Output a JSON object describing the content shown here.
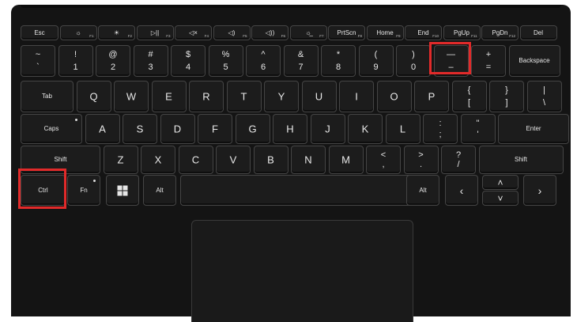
{
  "keyboard": {
    "fn_row": [
      {
        "name": "esc-key",
        "label": "Esc"
      },
      {
        "name": "f1-key",
        "label": "☼",
        "sub": "F1"
      },
      {
        "name": "f2-key",
        "label": "☀",
        "sub": "F2"
      },
      {
        "name": "f3-key",
        "label": "▷||",
        "sub": "F3"
      },
      {
        "name": "f4-key",
        "label": "◁×",
        "sub": "F4"
      },
      {
        "name": "f5-key",
        "label": "◁)",
        "sub": "F5"
      },
      {
        "name": "f6-key",
        "label": "◁))",
        "sub": "F6"
      },
      {
        "name": "f7-key",
        "label": "☼̲",
        "sub": "F7"
      },
      {
        "name": "prtscn-key",
        "label": "PrtScn",
        "sub": "F8"
      },
      {
        "name": "home-key",
        "label": "Home",
        "sub": "F9"
      },
      {
        "name": "end-key",
        "label": "End",
        "sub": "F10"
      },
      {
        "name": "pgup-key",
        "label": "PgUp",
        "sub": "F11"
      },
      {
        "name": "pgdn-key",
        "label": "PgDn",
        "sub": "F12"
      },
      {
        "name": "del-key",
        "label": "Del"
      }
    ],
    "number_row": [
      {
        "name": "tilde-key",
        "top": "~",
        "bottom": "`"
      },
      {
        "name": "1-key",
        "top": "!",
        "bottom": "1"
      },
      {
        "name": "2-key",
        "top": "@",
        "bottom": "2"
      },
      {
        "name": "3-key",
        "top": "#",
        "bottom": "3"
      },
      {
        "name": "4-key",
        "top": "$",
        "bottom": "4"
      },
      {
        "name": "5-key",
        "top": "%",
        "bottom": "5"
      },
      {
        "name": "6-key",
        "top": "^",
        "bottom": "6"
      },
      {
        "name": "7-key",
        "top": "&",
        "bottom": "7"
      },
      {
        "name": "8-key",
        "top": "*",
        "bottom": "8"
      },
      {
        "name": "9-key",
        "top": "(",
        "bottom": "9"
      },
      {
        "name": "0-key",
        "top": ")",
        "bottom": "0"
      },
      {
        "name": "minus-key",
        "top": "—",
        "bottom": "–"
      },
      {
        "name": "equals-key",
        "top": "+",
        "bottom": "="
      },
      {
        "name": "backspace-key",
        "label": "Backspace"
      }
    ],
    "qwerty_row": [
      {
        "name": "tab-key",
        "label": "Tab"
      },
      {
        "name": "q-key",
        "label": "Q"
      },
      {
        "name": "w-key",
        "label": "W"
      },
      {
        "name": "e-key",
        "label": "E"
      },
      {
        "name": "r-key",
        "label": "R"
      },
      {
        "name": "t-key",
        "label": "T"
      },
      {
        "name": "y-key",
        "label": "Y"
      },
      {
        "name": "u-key",
        "label": "U"
      },
      {
        "name": "i-key",
        "label": "I"
      },
      {
        "name": "o-key",
        "label": "O"
      },
      {
        "name": "p-key",
        "label": "P"
      },
      {
        "name": "bracket-left-key",
        "top": "{",
        "bottom": "["
      },
      {
        "name": "bracket-right-key",
        "top": "}",
        "bottom": "]"
      },
      {
        "name": "backslash-key",
        "top": "|",
        "bottom": "\\"
      }
    ],
    "home_row": [
      {
        "name": "caps-key",
        "label": "Caps"
      },
      {
        "name": "a-key",
        "label": "A"
      },
      {
        "name": "s-key",
        "label": "S"
      },
      {
        "name": "d-key",
        "label": "D"
      },
      {
        "name": "f-key",
        "label": "F"
      },
      {
        "name": "g-key",
        "label": "G"
      },
      {
        "name": "h-key",
        "label": "H"
      },
      {
        "name": "j-key",
        "label": "J"
      },
      {
        "name": "k-key",
        "label": "K"
      },
      {
        "name": "l-key",
        "label": "L"
      },
      {
        "name": "semicolon-key",
        "top": ":",
        "bottom": ";"
      },
      {
        "name": "quote-key",
        "top": "\"",
        "bottom": "'"
      },
      {
        "name": "enter-key",
        "label": "Enter"
      }
    ],
    "shift_row": [
      {
        "name": "shift-left-key",
        "label": "Shift"
      },
      {
        "name": "z-key",
        "label": "Z"
      },
      {
        "name": "x-key",
        "label": "X"
      },
      {
        "name": "c-key",
        "label": "C"
      },
      {
        "name": "v-key",
        "label": "V"
      },
      {
        "name": "b-key",
        "label": "B"
      },
      {
        "name": "n-key",
        "label": "N"
      },
      {
        "name": "m-key",
        "label": "M"
      },
      {
        "name": "comma-key",
        "top": "<",
        "bottom": ","
      },
      {
        "name": "period-key",
        "top": ">",
        "bottom": "."
      },
      {
        "name": "slash-key",
        "top": "?",
        "bottom": "/"
      },
      {
        "name": "shift-right-key",
        "label": "Shift"
      }
    ],
    "bottom_row": {
      "ctrl": "Ctrl",
      "fn": "Fn",
      "alt_left": "Alt",
      "alt_right": "Alt",
      "left_arrow": "‹",
      "up_arrow": "˄",
      "down_arrow": "˅",
      "right_arrow": "›"
    }
  },
  "highlights": {
    "color": "#e12a2a",
    "keys": [
      "minus-key",
      "ctrl-key"
    ]
  }
}
